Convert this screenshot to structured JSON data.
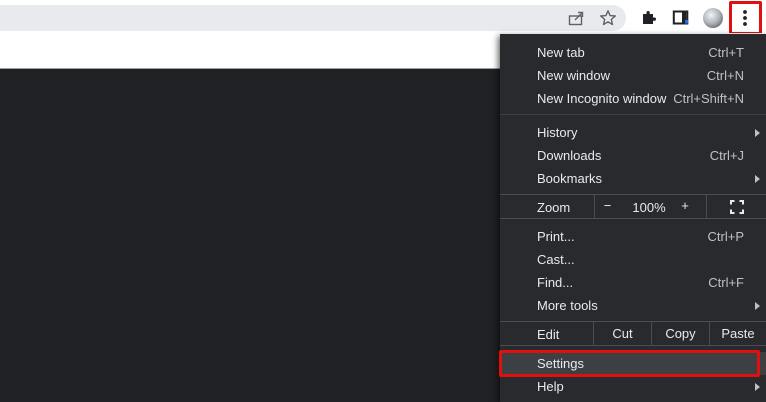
{
  "colors": {
    "menu_bg": "#292a2d",
    "page_dark": "#202124",
    "highlight": "#e01010"
  },
  "toolbar": {
    "share_icon": "share-icon",
    "bookmark_icon": "star-icon",
    "extensions_icon": "puzzle-icon",
    "side_panel_icon": "side-panel-icon",
    "profile_icon": "avatar",
    "menu_icon": "three-dots-vertical-icon"
  },
  "menu": {
    "new_tab": {
      "label": "New tab",
      "shortcut": "Ctrl+T"
    },
    "new_window": {
      "label": "New window",
      "shortcut": "Ctrl+N"
    },
    "new_incognito": {
      "label": "New Incognito window",
      "shortcut": "Ctrl+Shift+N"
    },
    "history": {
      "label": "History"
    },
    "downloads": {
      "label": "Downloads",
      "shortcut": "Ctrl+J"
    },
    "bookmarks": {
      "label": "Bookmarks"
    },
    "zoom": {
      "label": "Zoom",
      "minus": "−",
      "value": "100%",
      "plus": "+"
    },
    "print": {
      "label": "Print...",
      "shortcut": "Ctrl+P"
    },
    "cast": {
      "label": "Cast..."
    },
    "find": {
      "label": "Find...",
      "shortcut": "Ctrl+F"
    },
    "more_tools": {
      "label": "More tools"
    },
    "edit": {
      "label": "Edit",
      "cut": "Cut",
      "copy": "Copy",
      "paste": "Paste"
    },
    "settings": {
      "label": "Settings"
    },
    "help": {
      "label": "Help"
    }
  }
}
